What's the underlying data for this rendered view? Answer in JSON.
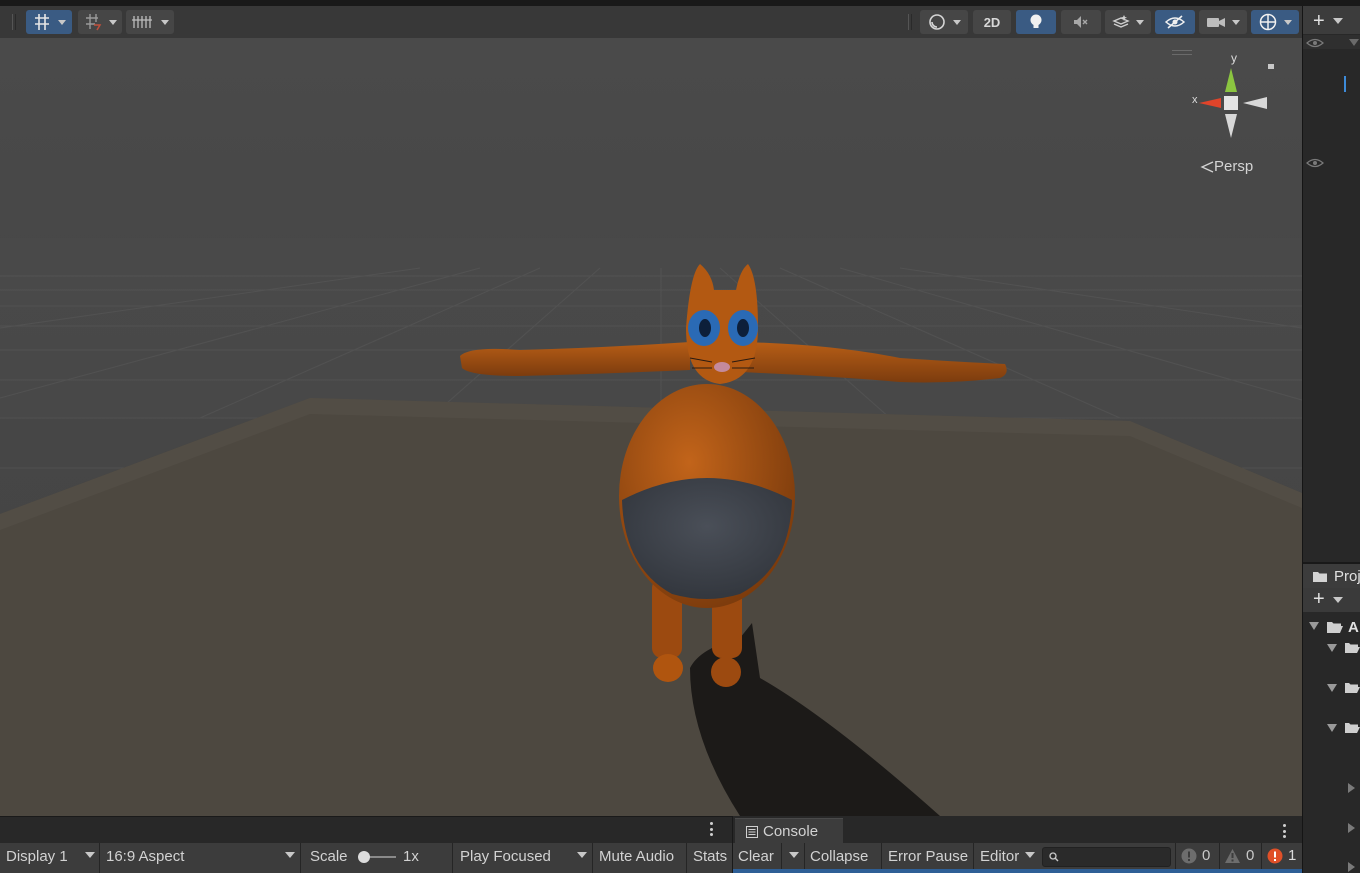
{
  "scene_view": {
    "gizmo": {
      "y_label": "y",
      "x_label": "x",
      "projection_label": "Persp"
    },
    "toolbar": {
      "two_d_label": "2D"
    }
  },
  "game_view": {
    "display_select": "Display 1",
    "aspect_select": "16:9 Aspect",
    "scale_label": "Scale",
    "scale_value": "1x",
    "play_mode_select": "Play Focused",
    "mute_audio_label": "Mute Audio",
    "stats_label": "Stats"
  },
  "console": {
    "tab_label": "Console",
    "clear_label": "Clear",
    "collapse_label": "Collapse",
    "error_pause_label": "Error Pause",
    "editor_select": "Editor",
    "search_placeholder": "",
    "info_count": "0",
    "warning_count": "0",
    "error_count": "1"
  },
  "project": {
    "tab_label": "Proj",
    "folder_label": "A"
  },
  "colors": {
    "accent_blue": "#3a5b83",
    "panel_bg": "#282828",
    "toolbar_bg": "#383838",
    "error_red": "#e05028",
    "character_orange": "#b85a14"
  }
}
